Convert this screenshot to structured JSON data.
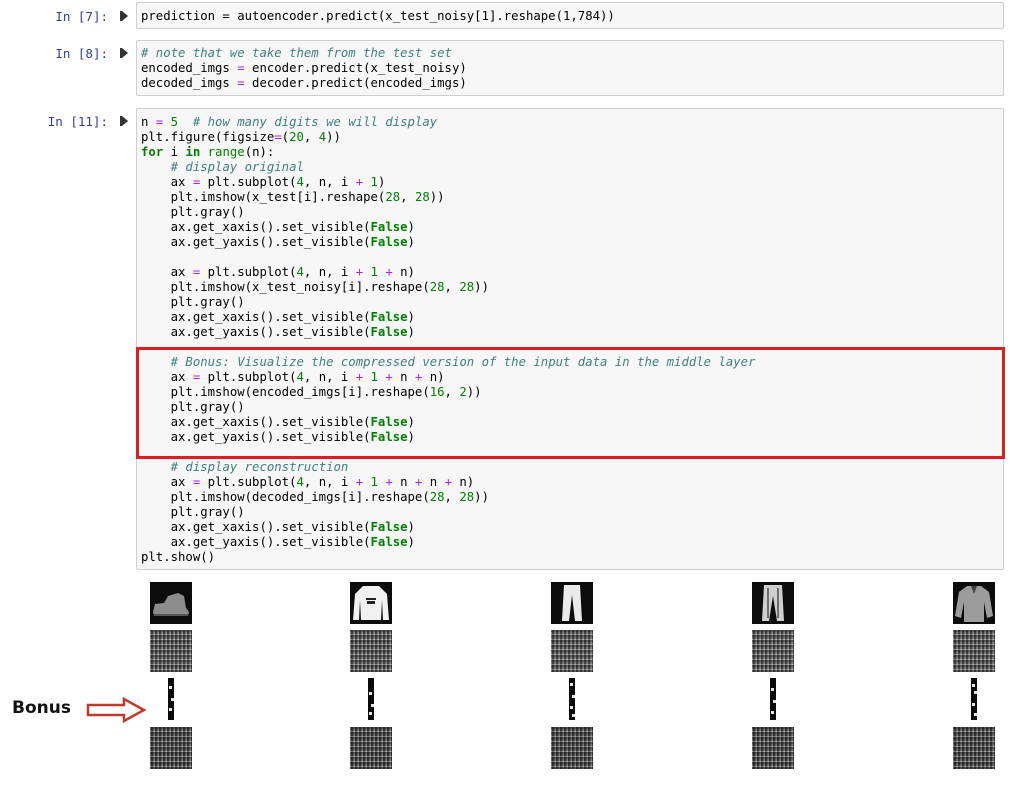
{
  "cells": [
    {
      "prompt": "In [7]:",
      "lines": [
        "prediction = autoencoder.predict(x_test_noisy[1].reshape(1,784))"
      ]
    },
    {
      "prompt": "In [8]:",
      "lines": [
        "# note that we take them from the test set",
        "encoded_imgs = encoder.predict(x_test_noisy)",
        "decoded_imgs = decoder.predict(encoded_imgs)"
      ]
    },
    {
      "prompt": "In [11]:",
      "lines": [
        "n = 5  # how many digits we will display",
        "plt.figure(figsize=(20, 4))",
        "for i in range(n):",
        "    # display original",
        "    ax = plt.subplot(4, n, i + 1)",
        "    plt.imshow(x_test[i].reshape(28, 28))",
        "    plt.gray()",
        "    ax.get_xaxis().set_visible(False)",
        "    ax.get_yaxis().set_visible(False)",
        "",
        "    ax = plt.subplot(4, n, i + 1 + n)",
        "    plt.imshow(x_test_noisy[i].reshape(28, 28))",
        "    plt.gray()",
        "    ax.get_xaxis().set_visible(False)",
        "    ax.get_yaxis().set_visible(False)",
        "",
        "    # Bonus: Visualize the compressed version of the input data in the middle layer",
        "    ax = plt.subplot(4, n, i + 1 + n + n)",
        "    plt.imshow(encoded_imgs[i].reshape(16, 2))",
        "    plt.gray()",
        "    ax.get_xaxis().set_visible(False)",
        "    ax.get_yaxis().set_visible(False)",
        "",
        "    # display reconstruction",
        "    ax = plt.subplot(4, n, i + 1 + n + n + n)",
        "    plt.imshow(decoded_imgs[i].reshape(28, 28))",
        "    plt.gray()",
        "    ax.get_xaxis().set_visible(False)",
        "    ax.get_yaxis().set_visible(False)",
        "plt.show()"
      ]
    }
  ],
  "output": {
    "columns": 5,
    "rows": [
      "original",
      "noisy",
      "encoded",
      "reconstruction"
    ],
    "original_items": [
      "ankle-boot",
      "sweater",
      "trousers",
      "trousers",
      "shirt"
    ]
  },
  "annotation": {
    "label": "Bonus",
    "highlight_color": "#e01b24",
    "arrow_color": "#c0392b"
  }
}
